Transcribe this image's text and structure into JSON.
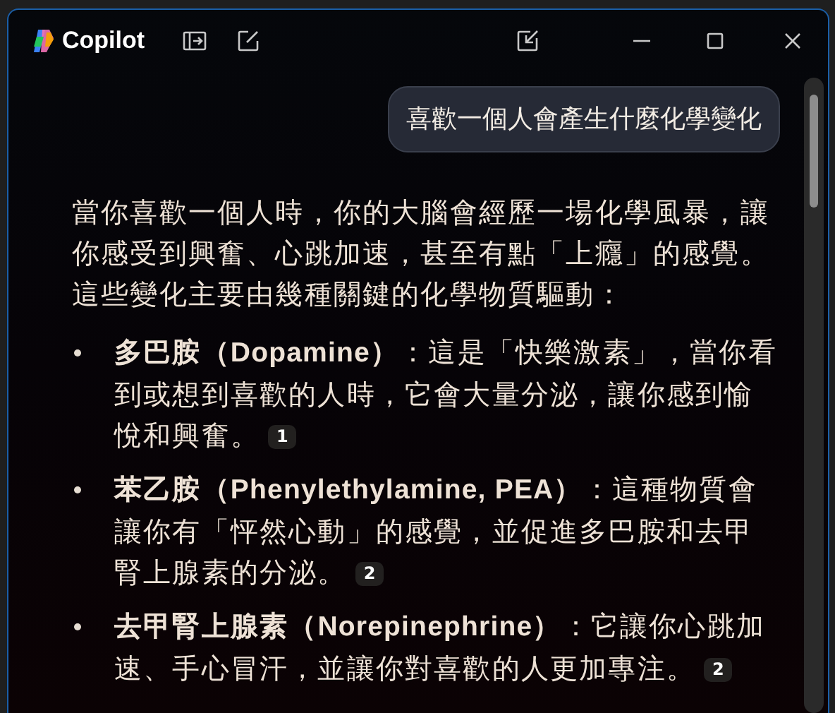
{
  "window": {
    "title": "Copilot"
  },
  "user_message": "喜歡一個人會產生什麼化學變化",
  "reply": {
    "intro": "當你喜歡一個人時，你的大腦會經歷一場化學風暴，讓你感受到興奮、心跳加速，甚至有點「上癮」的感覺。這些變化主要由幾種關鍵的化學物質驅動：",
    "items": [
      {
        "text": "**多巴胺（Dopamine）**：這是「快樂激素」，當你看到或想到喜歡的人時，它會大量分泌，讓你感到愉悅和興奮。",
        "citation": "1"
      },
      {
        "text": "**苯乙胺（Phenylethylamine, PEA）**：這種物質會讓你有「怦然心動」的感覺，並促進多巴胺和去甲腎上腺素的分泌。",
        "citation": "2"
      },
      {
        "text": "**去甲腎上腺素（Norepinephrine）**：它讓你心跳加速、手心冒汗，並讓你對喜歡的人更加專注。",
        "citation": "2"
      }
    ]
  }
}
